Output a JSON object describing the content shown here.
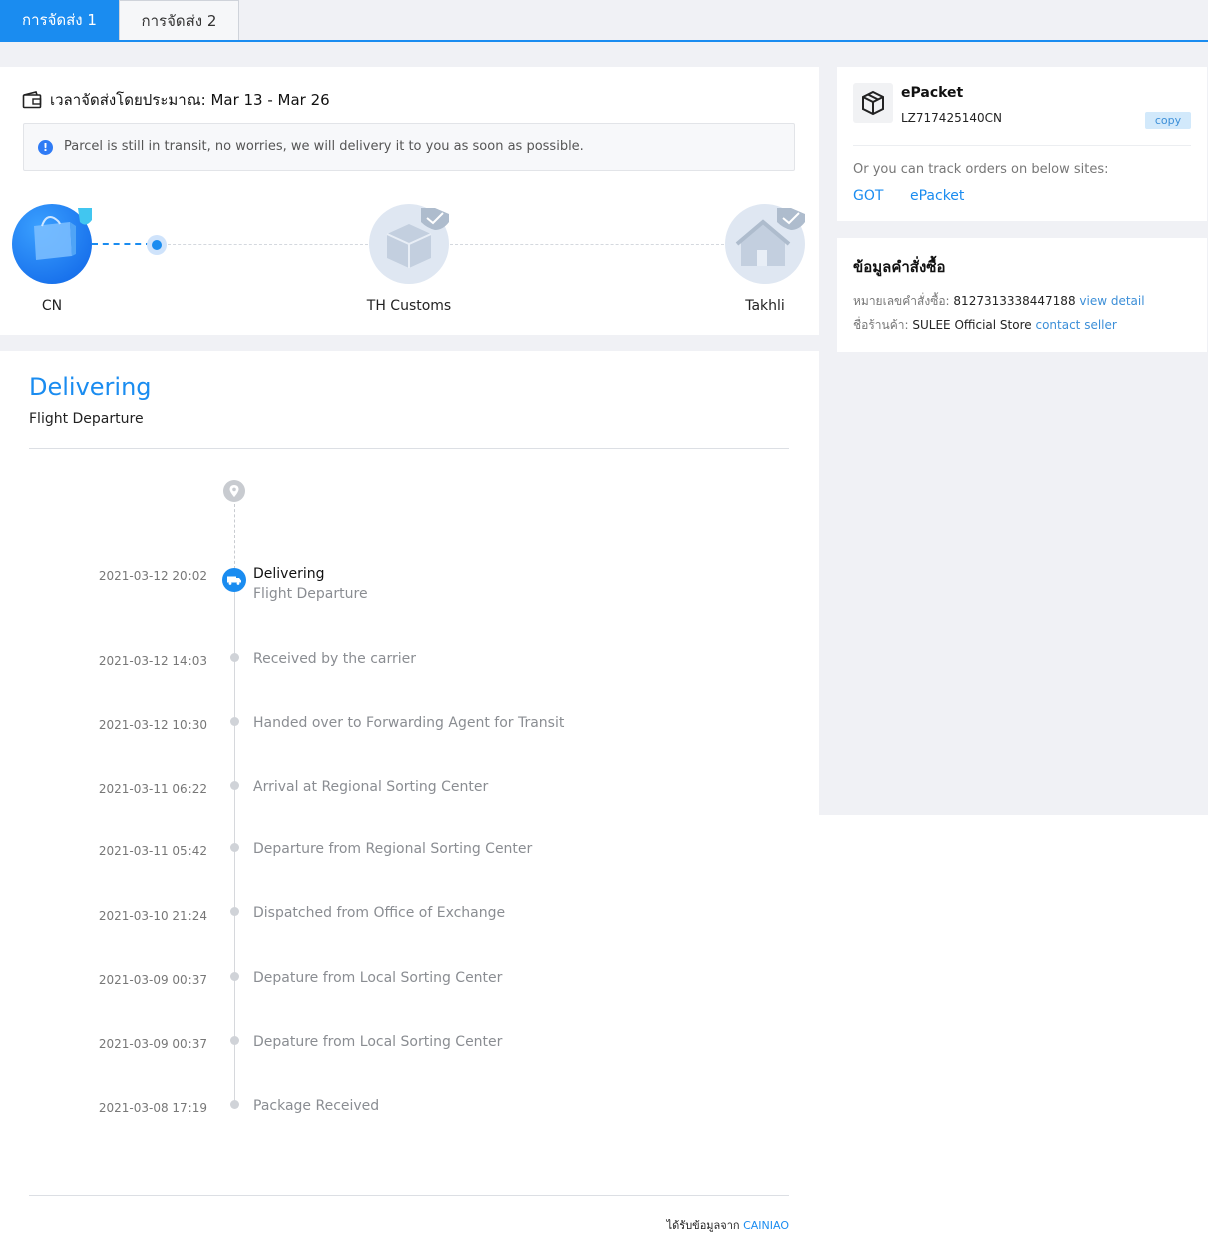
{
  "tabs": [
    "การจัดส่ง 1",
    "การจัดส่ง 2"
  ],
  "estimate": {
    "label": "เวลาจัดส่งโดยประมาณ: Mar 13 - Mar 26",
    "notice": "Parcel is still in transit, no worries, we will delivery it to you as soon as possible."
  },
  "progress": {
    "origin": "CN",
    "customs": "TH Customs",
    "destination": "Takhli"
  },
  "status": {
    "title": "Delivering",
    "subtitle": "Flight Departure"
  },
  "timeline": [
    {
      "time": "2021-03-12 20:02",
      "title": "Delivering",
      "desc": "Flight Departure"
    },
    {
      "time": "2021-03-12 14:03",
      "title": "Received by the carrier"
    },
    {
      "time": "2021-03-12 10:30",
      "title": "Handed over to Forwarding Agent for Transit"
    },
    {
      "time": "2021-03-11 06:22",
      "title": "Arrival at Regional Sorting Center"
    },
    {
      "time": "2021-03-11 05:42",
      "title": "Departure from Regional Sorting Center"
    },
    {
      "time": "2021-03-10 21:24",
      "title": "Dispatched from Office of Exchange"
    },
    {
      "time": "2021-03-09 00:37",
      "title": "Depature from Local Sorting Center"
    },
    {
      "time": "2021-03-09 00:37",
      "title": "Depature from Local Sorting Center"
    },
    {
      "time": "2021-03-08 17:19",
      "title": "Package Received"
    }
  ],
  "source": {
    "label": "ได้รับข้อมูลจาก",
    "link": "CAINIAO"
  },
  "carrier": {
    "name": "ePacket",
    "tracking": "LZ717425140CN",
    "copy": "copy",
    "hint": "Or you can track orders on below sites:",
    "sites": [
      "GOT",
      "ePacket"
    ]
  },
  "order": {
    "title": "ข้อมูลคำสั่งซื้อ",
    "number_label": "หมายเลขคำสั่งซื้อ:",
    "number": "8127313338447188",
    "view_detail": "view detail",
    "store_label": "ชื่อร้านค้า:",
    "store": "SULEE Official Store",
    "contact": "contact seller"
  },
  "colors": {
    "accent": "#1a8cf0",
    "page_bg": "#f0f1f5"
  }
}
